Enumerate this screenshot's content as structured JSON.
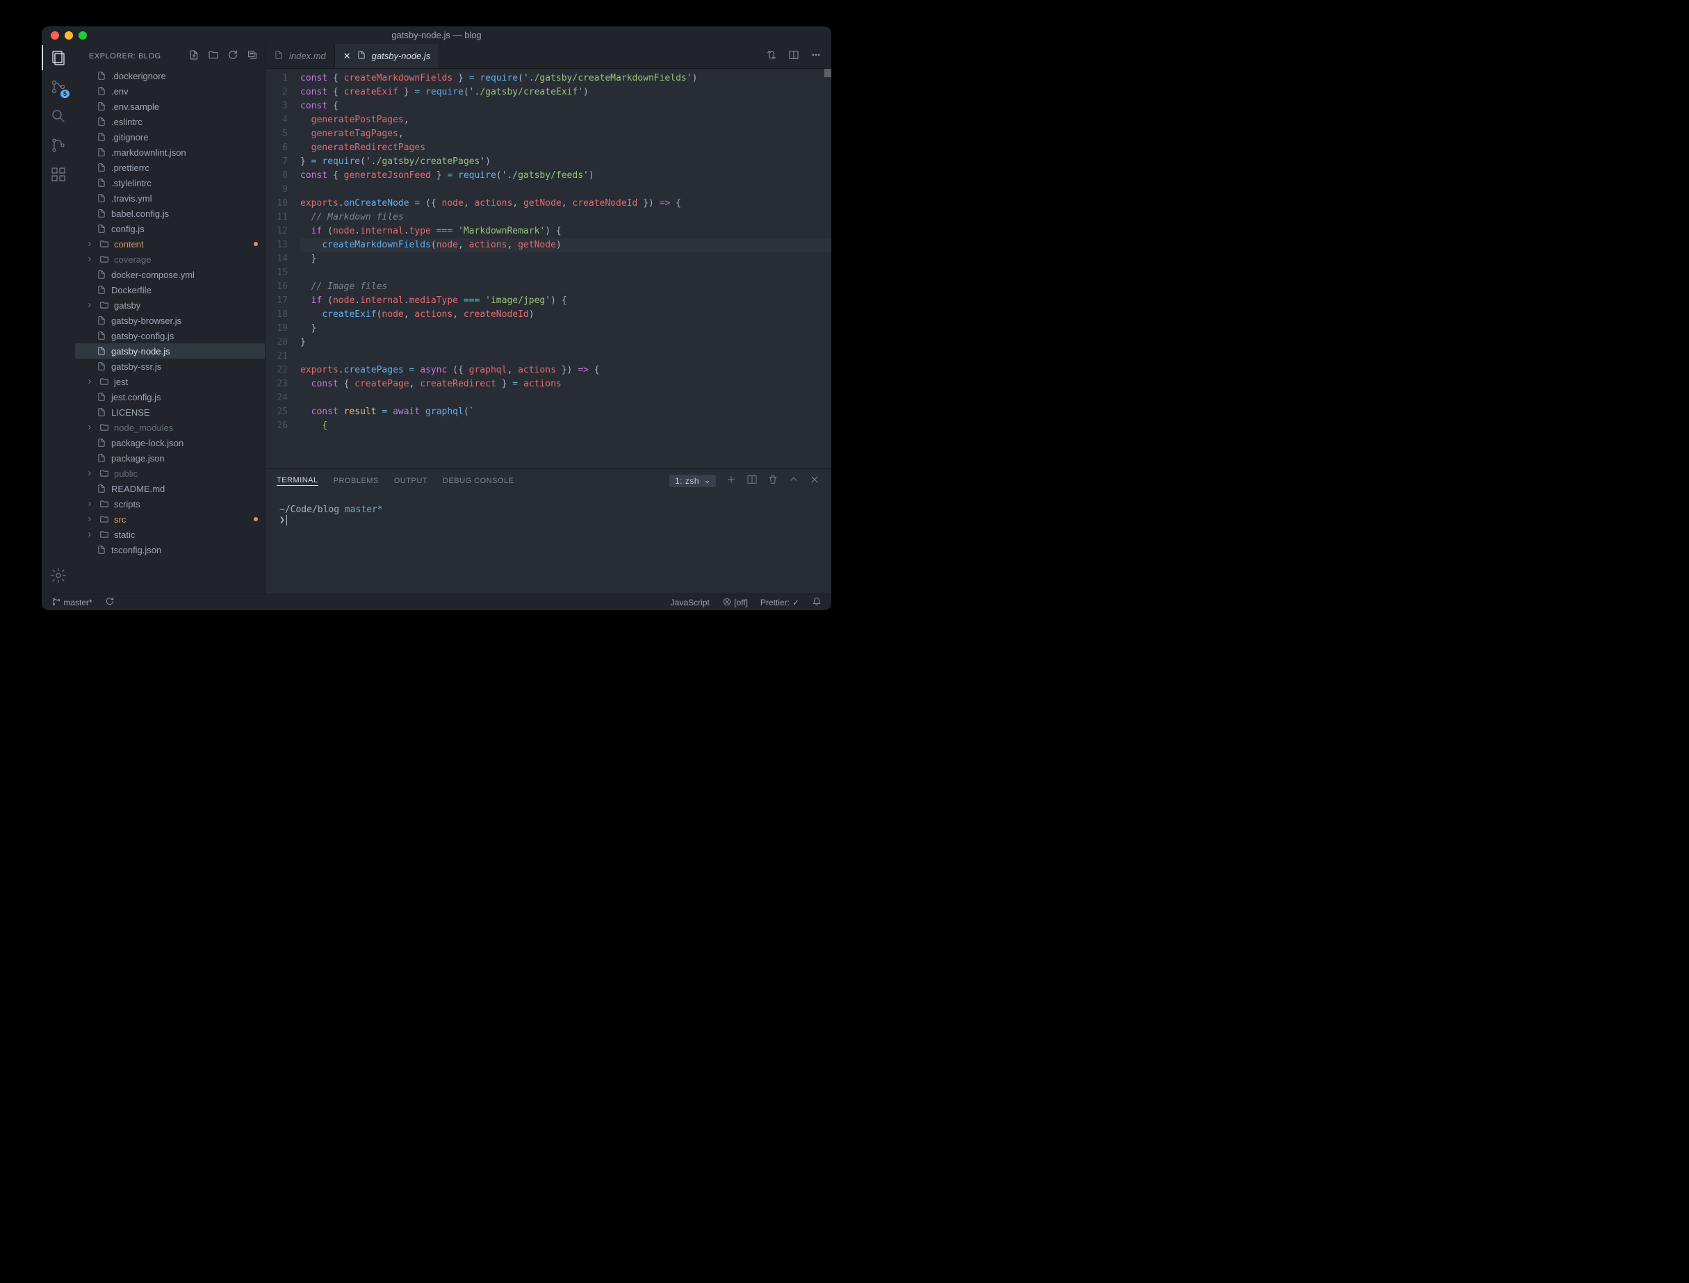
{
  "window": {
    "title": "gatsby-node.js — blog"
  },
  "activity": {
    "badge_scm": "5"
  },
  "sidebar": {
    "header": "EXPLORER: BLOG",
    "items": [
      {
        "label": ".dockerignore",
        "indent": 30,
        "type": "file"
      },
      {
        "label": ".env",
        "indent": 30,
        "type": "file"
      },
      {
        "label": ".env.sample",
        "indent": 30,
        "type": "file"
      },
      {
        "label": ".eslintrc",
        "indent": 30,
        "type": "file"
      },
      {
        "label": ".gitignore",
        "indent": 30,
        "type": "file"
      },
      {
        "label": ".markdownlint.json",
        "indent": 30,
        "type": "file"
      },
      {
        "label": ".prettierrc",
        "indent": 30,
        "type": "file"
      },
      {
        "label": ".stylelintrc",
        "indent": 30,
        "type": "file"
      },
      {
        "label": ".travis.yml",
        "indent": 30,
        "type": "file"
      },
      {
        "label": "babel.config.js",
        "indent": 30,
        "type": "file"
      },
      {
        "label": "config.js",
        "indent": 30,
        "type": "file"
      },
      {
        "label": "content",
        "indent": 14,
        "type": "folder",
        "modified": true,
        "dot": true
      },
      {
        "label": "coverage",
        "indent": 14,
        "type": "folder",
        "dim": true
      },
      {
        "label": "docker-compose.yml",
        "indent": 30,
        "type": "file"
      },
      {
        "label": "Dockerfile",
        "indent": 30,
        "type": "file"
      },
      {
        "label": "gatsby",
        "indent": 14,
        "type": "folder"
      },
      {
        "label": "gatsby-browser.js",
        "indent": 30,
        "type": "file"
      },
      {
        "label": "gatsby-config.js",
        "indent": 30,
        "type": "file"
      },
      {
        "label": "gatsby-node.js",
        "indent": 30,
        "type": "file",
        "selected": true
      },
      {
        "label": "gatsby-ssr.js",
        "indent": 30,
        "type": "file"
      },
      {
        "label": "jest",
        "indent": 14,
        "type": "folder"
      },
      {
        "label": "jest.config.js",
        "indent": 30,
        "type": "file"
      },
      {
        "label": "LICENSE",
        "indent": 30,
        "type": "file"
      },
      {
        "label": "node_modules",
        "indent": 14,
        "type": "folder",
        "dim": true
      },
      {
        "label": "package-lock.json",
        "indent": 30,
        "type": "file"
      },
      {
        "label": "package.json",
        "indent": 30,
        "type": "file"
      },
      {
        "label": "public",
        "indent": 14,
        "type": "folder",
        "dim": true
      },
      {
        "label": "README.md",
        "indent": 30,
        "type": "file"
      },
      {
        "label": "scripts",
        "indent": 14,
        "type": "folder"
      },
      {
        "label": "src",
        "indent": 14,
        "type": "folder",
        "modified": true,
        "dot": true
      },
      {
        "label": "static",
        "indent": 14,
        "type": "folder"
      },
      {
        "label": "tsconfig.json",
        "indent": 30,
        "type": "file"
      }
    ]
  },
  "tabs": [
    {
      "label": "index.md",
      "active": false,
      "closeable": false
    },
    {
      "label": "gatsby-node.js",
      "active": true,
      "closeable": true
    }
  ],
  "editor": {
    "lines": [
      {
        "n": 1,
        "html": "<span class=k>const</span> <span class=p>{</span> <span class=v>createMarkdownFields</span> <span class=p>}</span> <span class=o>=</span> <span class=fn>require</span><span class=p>(</span><span class=s>'./gatsby/createMarkdownFields'</span><span class=p>)</span>"
      },
      {
        "n": 2,
        "html": "<span class=k>const</span> <span class=p>{</span> <span class=v>createExif</span> <span class=p>}</span> <span class=o>=</span> <span class=fn>require</span><span class=p>(</span><span class=s>'./gatsby/createExif'</span><span class=p>)</span>"
      },
      {
        "n": 3,
        "html": "<span class=k>const</span> <span class=p>{</span>"
      },
      {
        "n": 4,
        "html": "  <span class=v>generatePostPages</span><span class=p>,</span>"
      },
      {
        "n": 5,
        "html": "  <span class=v>generateTagPages</span><span class=p>,</span>"
      },
      {
        "n": 6,
        "html": "  <span class=v>generateRedirectPages</span>"
      },
      {
        "n": 7,
        "html": "<span class=p>}</span> <span class=o>=</span> <span class=fn>require</span><span class=p>(</span><span class=s>'./gatsby/createPages'</span><span class=p>)</span>"
      },
      {
        "n": 8,
        "html": "<span class=k>const</span> <span class=p>{</span> <span class=v>generateJsonFeed</span> <span class=p>}</span> <span class=o>=</span> <span class=fn>require</span><span class=p>(</span><span class=s>'./gatsby/feeds'</span><span class=p>)</span>"
      },
      {
        "n": 9,
        "html": ""
      },
      {
        "n": 10,
        "html": "<span class=v>exports</span><span class=p>.</span><span class=fn>onCreateNode</span> <span class=o>=</span> <span class=p>({</span> <span class=v>node</span><span class=p>,</span> <span class=v>actions</span><span class=p>,</span> <span class=v>getNode</span><span class=p>,</span> <span class=v>createNodeId</span> <span class=p>})</span> <span class=k>=&gt;</span> <span class=p>{</span>"
      },
      {
        "n": 11,
        "html": "  <span class=c>// Markdown files</span>"
      },
      {
        "n": 12,
        "html": "  <span class=k>if</span> <span class=p>(</span><span class=v>node</span><span class=p>.</span><span class=v>internal</span><span class=p>.</span><span class=v>type</span> <span class=o>===</span> <span class=s>'MarkdownRemark'</span><span class=p>) {</span>"
      },
      {
        "n": 13,
        "html": "    <span class=fn>createMarkdownFields</span><span class=p>(</span><span class=v>node</span><span class=p>,</span> <span class=v>actions</span><span class=p>,</span> <span class=v>getNode</span><span class=p>)</span>",
        "hl": true
      },
      {
        "n": 14,
        "html": "  <span class=p>}</span>"
      },
      {
        "n": 15,
        "html": ""
      },
      {
        "n": 16,
        "html": "  <span class=c>// Image files</span>"
      },
      {
        "n": 17,
        "html": "  <span class=k>if</span> <span class=p>(</span><span class=v>node</span><span class=p>.</span><span class=v>internal</span><span class=p>.</span><span class=v>mediaType</span> <span class=o>===</span> <span class=s>'image/jpeg'</span><span class=p>) {</span>"
      },
      {
        "n": 18,
        "html": "    <span class=fn>createExif</span><span class=p>(</span><span class=v>node</span><span class=p>,</span> <span class=v>actions</span><span class=p>,</span> <span class=v>createNodeId</span><span class=p>)</span>"
      },
      {
        "n": 19,
        "html": "  <span class=p>}</span>"
      },
      {
        "n": 20,
        "html": "<span class=p>}</span>"
      },
      {
        "n": 21,
        "html": ""
      },
      {
        "n": 22,
        "html": "<span class=v>exports</span><span class=p>.</span><span class=fn>createPages</span> <span class=o>=</span> <span class=k>async</span> <span class=p>({</span> <span class=v>graphql</span><span class=p>,</span> <span class=v>actions</span> <span class=p>})</span> <span class=k>=&gt;</span> <span class=p>{</span>"
      },
      {
        "n": 23,
        "html": "  <span class=k>const</span> <span class=p>{</span> <span class=v>createPage</span><span class=p>,</span> <span class=v>createRedirect</span> <span class=p>}</span> <span class=o>=</span> <span class=v>actions</span>"
      },
      {
        "n": 24,
        "html": ""
      },
      {
        "n": 25,
        "html": "  <span class=k>const</span> <span class=pr>result</span> <span class=o>=</span> <span class=k>await</span> <span class=fn>graphql</span><span class=p>(</span><span class=s>`</span>"
      },
      {
        "n": 26,
        "html": "    <span class=s>{</span>"
      }
    ]
  },
  "panel": {
    "tabs": [
      "TERMINAL",
      "PROBLEMS",
      "OUTPUT",
      "DEBUG CONSOLE"
    ],
    "active": 0,
    "terminal_select": "1: zsh",
    "prompt_path": "~/Code/blog",
    "prompt_branch": "master*",
    "prompt_symbol": "❯"
  },
  "status": {
    "branch": "master*",
    "language": "JavaScript",
    "eslint": "[off]",
    "prettier": "Prettier:"
  }
}
